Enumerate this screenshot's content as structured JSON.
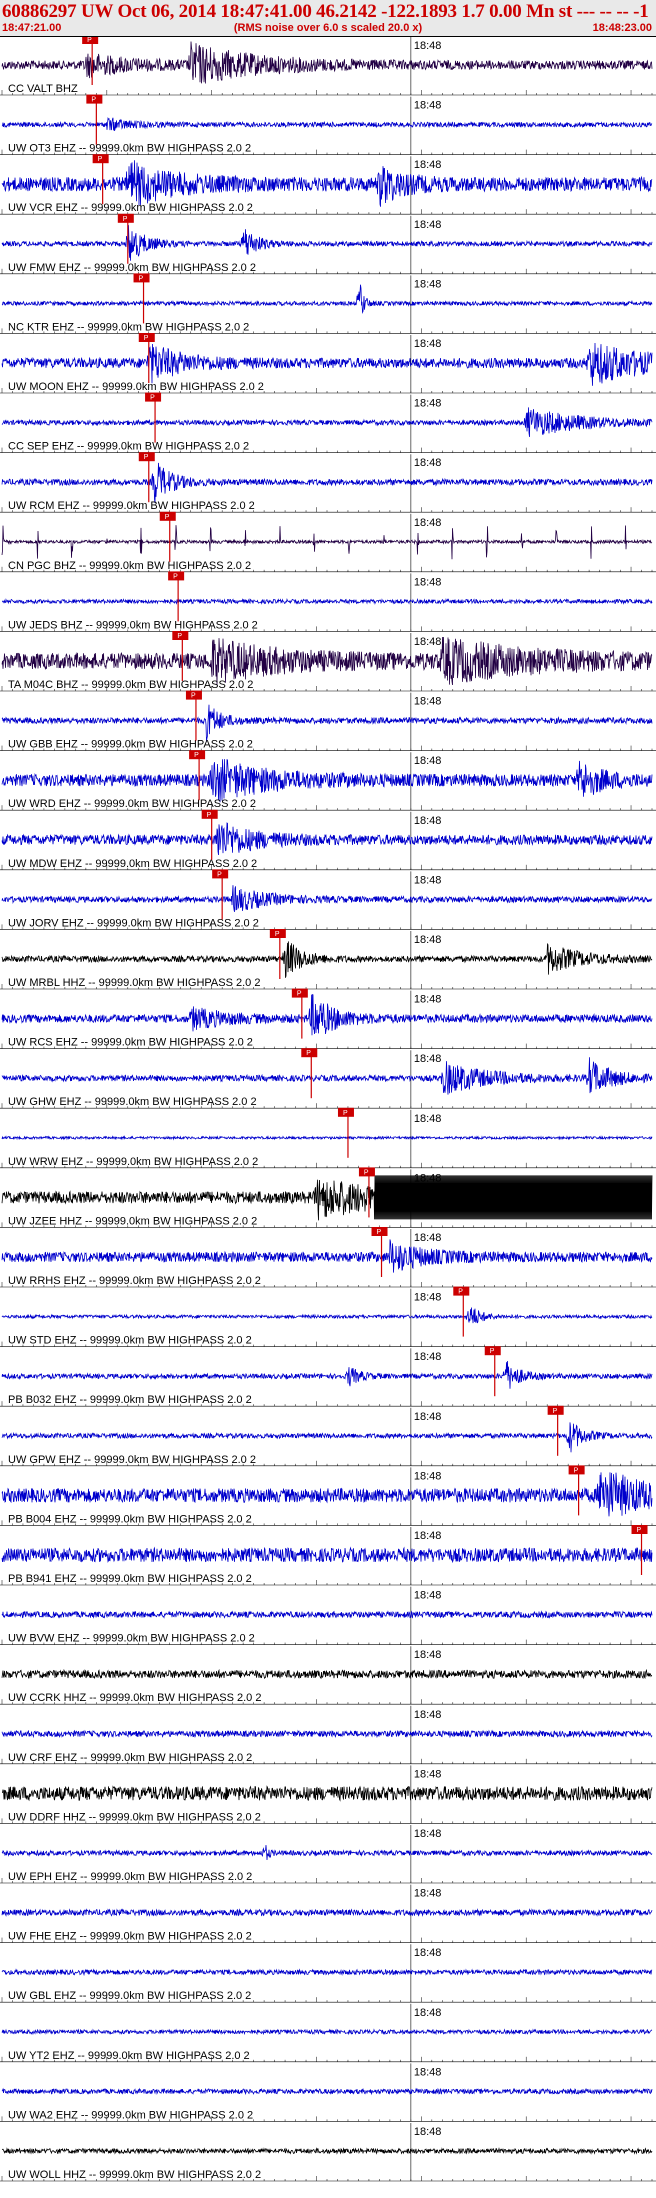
{
  "header": {
    "title": "60886297 UW Oct 06, 2014 18:47:41.00   46.2142 -122.1893  1.7 0.00 Mn st --- -- -- -1",
    "start_time": "18:47:21.00",
    "rms_note": "(RMS noise over 6.0 s scaled 20.0 x)",
    "end_time": "18:48:23.00"
  },
  "chart_data": {
    "type": "line",
    "x_range_sec": [
      0,
      62
    ],
    "minute_mark": {
      "label": "18:48",
      "t": 39
    },
    "pick_label": "P",
    "colors": {
      "blue": "#0000cc",
      "purple": "#220044",
      "black": "#000000",
      "pick": "#cc0000"
    },
    "series": [
      {
        "name": "CC VALT BHZ",
        "label": "CC VALT BHZ",
        "color": "purple",
        "pick_t": 8.6,
        "amp": 0.22,
        "bursts": [
          [
            18,
            0.95,
            6
          ],
          [
            8,
            0.5,
            4
          ]
        ]
      },
      {
        "name": "UW OT3 EHZ",
        "label": "UW OT3 EHZ -- 99999.0km BW  HIGHPASS  2.0  2",
        "color": "blue",
        "pick_t": 9.0,
        "amp": 0.12,
        "bursts": [
          [
            10,
            0.3,
            2
          ]
        ]
      },
      {
        "name": "UW VCR EHZ",
        "label": "UW VCR EHZ -- 99999.0km BW  HIGHPASS  2.0  2",
        "color": "blue",
        "pick_t": 9.6,
        "amp": 0.35,
        "bursts": [
          [
            12,
            1.0,
            4
          ],
          [
            36,
            0.9,
            2
          ]
        ]
      },
      {
        "name": "UW FMW EHZ",
        "label": "UW FMW EHZ -- 99999.0km BW  HIGHPASS  2.0  2",
        "color": "blue",
        "pick_t": 12.0,
        "amp": 0.12,
        "bursts": [
          [
            12,
            1.0,
            1.5
          ],
          [
            23,
            0.9,
            1.2
          ]
        ]
      },
      {
        "name": "NC KTR EHZ",
        "label": "NC KTR EHZ -- 99999.0km BW  HIGHPASS  2.0  2",
        "color": "blue",
        "pick_t": 13.5,
        "amp": 0.1,
        "bursts": [
          [
            34,
            1.4,
            0.4
          ]
        ]
      },
      {
        "name": "UW MOON EHZ",
        "label": "UW MOON EHZ -- 99999.0km BW  HIGHPASS  2.0  2",
        "color": "blue",
        "pick_t": 14.0,
        "amp": 0.25,
        "bursts": [
          [
            14,
            0.9,
            3
          ],
          [
            56,
            1.0,
            5
          ]
        ]
      },
      {
        "name": "CC SEP EHZ",
        "label": "CC SEP EHZ -- 99999.0km BW  HIGHPASS  2.0  2",
        "color": "blue",
        "pick_t": 14.6,
        "amp": 0.12,
        "bursts": [
          [
            50,
            0.7,
            5
          ]
        ]
      },
      {
        "name": "UW RCM EHZ",
        "label": "UW RCM EHZ -- 99999.0km BW  HIGHPASS  2.0  2",
        "color": "blue",
        "pick_t": 14.0,
        "amp": 0.15,
        "bursts": [
          [
            14.5,
            1.1,
            1.5
          ]
        ]
      },
      {
        "name": "CN PGC BHZ",
        "label": "CN PGC BHZ -- 99999.0km BW  HIGHPASS  2.0  2",
        "color": "purple",
        "pick_t": 16.0,
        "amp": 0.08,
        "spikes": true
      },
      {
        "name": "UW JEDS BHZ",
        "label": "UW JEDS BHZ -- 99999.0km BW  HIGHPASS  2.0  2",
        "color": "blue",
        "pick_t": 16.8,
        "amp": 0.1,
        "bursts": []
      },
      {
        "name": "TA M04C BHZ",
        "label": "TA M04C BHZ -- 99999.0km BW  HIGHPASS  2.0  2",
        "color": "purple",
        "pick_t": 17.2,
        "amp": 0.4,
        "bursts": [
          [
            20,
            0.9,
            6
          ],
          [
            42,
            0.9,
            8
          ]
        ]
      },
      {
        "name": "UW GBB EHZ",
        "label": "UW GBB EHZ -- 99999.0km BW  HIGHPASS  2.0  2",
        "color": "blue",
        "pick_t": 18.5,
        "amp": 0.15,
        "bursts": [
          [
            19.5,
            0.9,
            1.2
          ]
        ]
      },
      {
        "name": "UW WRD EHZ",
        "label": "UW WRD EHZ -- 99999.0km BW  HIGHPASS  2.0  2",
        "color": "blue",
        "pick_t": 18.8,
        "amp": 0.3,
        "bursts": [
          [
            20,
            1.0,
            5
          ],
          [
            55,
            0.9,
            2
          ]
        ]
      },
      {
        "name": "UW MDW EHZ",
        "label": "UW MDW EHZ -- 99999.0km BW  HIGHPASS  2.0  2",
        "color": "blue",
        "pick_t": 20.0,
        "amp": 0.25,
        "bursts": [
          [
            20.5,
            0.9,
            3
          ]
        ]
      },
      {
        "name": "UW JORV EHZ",
        "label": "UW JORV EHZ -- 99999.0km BW  HIGHPASS  2.0  2",
        "color": "blue",
        "pick_t": 21.0,
        "amp": 0.15,
        "bursts": [
          [
            22,
            0.6,
            3
          ]
        ]
      },
      {
        "name": "UW MRBL HHZ",
        "label": "UW MRBL HHZ -- 99999.0km BW  HIGHPASS  2.0  2",
        "color": "black",
        "pick_t": 26.5,
        "amp": 0.15,
        "bursts": [
          [
            27,
            1.0,
            1.5
          ],
          [
            52,
            0.7,
            3
          ]
        ]
      },
      {
        "name": "UW RCS EHZ",
        "label": "UW RCS EHZ -- 99999.0km BW  HIGHPASS  2.0  2",
        "color": "blue",
        "pick_t": 28.6,
        "amp": 0.2,
        "bursts": [
          [
            29.5,
            1.2,
            2
          ],
          [
            18,
            0.5,
            3
          ]
        ]
      },
      {
        "name": "UW GHW EHZ",
        "label": "UW GHW EHZ -- 99999.0km BW  HIGHPASS  2.0  2",
        "color": "blue",
        "pick_t": 29.5,
        "amp": 0.15,
        "bursts": [
          [
            42,
            0.8,
            4
          ],
          [
            56,
            0.9,
            2
          ]
        ]
      },
      {
        "name": "UW WRW EHZ",
        "label": "UW WRW EHZ -- 99999.0km BW  HIGHPASS  2.0  2",
        "color": "blue",
        "pick_t": 33.0,
        "amp": 0.06,
        "bursts": []
      },
      {
        "name": "UW JZEE HHZ",
        "label": "UW JZEE HHZ -- 99999.0km BW  HIGHPASS  2.0  2",
        "color": "black",
        "pick_t": 35.0,
        "amp": 0.3,
        "bursts": [
          [
            30,
            0.9,
            6
          ]
        ],
        "clip_from": 35.5
      },
      {
        "name": "UW RRHS EHZ",
        "label": "UW RRHS EHZ -- 99999.0km BW  HIGHPASS  2.0  2",
        "color": "blue",
        "pick_t": 36.2,
        "amp": 0.25,
        "bursts": [
          [
            37,
            0.7,
            3
          ]
        ]
      },
      {
        "name": "UW STD EHZ",
        "label": "UW STD EHZ -- 99999.0km BW  HIGHPASS  2.0  2",
        "color": "blue",
        "pick_t": 44.0,
        "amp": 0.08,
        "bursts": [
          [
            44.5,
            0.7,
            1
          ]
        ]
      },
      {
        "name": "PB B032 EHZ",
        "label": "PB B032 EHZ -- 99999.0km BW  HIGHPASS  2.0  2",
        "color": "blue",
        "pick_t": 47.0,
        "amp": 0.12,
        "bursts": [
          [
            48,
            0.8,
            1.2
          ],
          [
            33,
            0.5,
            1
          ]
        ]
      },
      {
        "name": "UW GPW EHZ",
        "label": "UW GPW EHZ -- 99999.0km BW  HIGHPASS  2.0  2",
        "color": "blue",
        "pick_t": 53.0,
        "amp": 0.12,
        "bursts": [
          [
            54,
            0.9,
            1.2
          ]
        ]
      },
      {
        "name": "PB B004 EHZ",
        "label": "PB B004 EHZ -- 99999.0km BW  HIGHPASS  2.0  2",
        "color": "blue",
        "pick_t": 55.0,
        "amp": 0.35,
        "bursts": [
          [
            57,
            1.2,
            4
          ]
        ]
      },
      {
        "name": "PB B941 EHZ",
        "label": "PB B941 EHZ -- 99999.0km BW  HIGHPASS  2.0  2",
        "color": "blue",
        "pick_t": 61.0,
        "amp": 0.35,
        "bursts": []
      },
      {
        "name": "UW BVW EHZ",
        "label": "UW BVW EHZ -- 99999.0km BW  HIGHPASS  2.0  2",
        "color": "blue",
        "amp": 0.15,
        "bursts": []
      },
      {
        "name": "UW CCRK HHZ",
        "label": "UW CCRK HHZ -- 99999.0km BW  HIGHPASS  2.0  2",
        "color": "black",
        "amp": 0.2,
        "bursts": []
      },
      {
        "name": "UW CRF EHZ",
        "label": "UW CRF EHZ -- 99999.0km BW  HIGHPASS  2.0  2",
        "color": "blue",
        "amp": 0.15,
        "bursts": []
      },
      {
        "name": "UW DDRF HHZ",
        "label": "UW DDRF HHZ -- 99999.0km BW  HIGHPASS  2.0  2",
        "color": "black",
        "amp": 0.35,
        "bursts": []
      },
      {
        "name": "UW EPH EHZ",
        "label": "UW EPH EHZ -- 99999.0km BW  HIGHPASS  2.0  2",
        "color": "blue",
        "amp": 0.12,
        "bursts": [
          [
            25,
            0.6,
            0.3
          ]
        ]
      },
      {
        "name": "UW FHE EHZ",
        "label": "UW FHE EHZ -- 99999.0km BW  HIGHPASS  2.0  2",
        "color": "blue",
        "amp": 0.15,
        "bursts": []
      },
      {
        "name": "UW GBL EHZ",
        "label": "UW GBL EHZ -- 99999.0km BW  HIGHPASS  2.0  2",
        "color": "blue",
        "amp": 0.12,
        "bursts": []
      },
      {
        "name": "UW YT2 EHZ",
        "label": "UW YT2 EHZ -- 99999.0km BW  HIGHPASS  2.0  2",
        "color": "blue",
        "amp": 0.1,
        "bursts": []
      },
      {
        "name": "UW WA2 EHZ",
        "label": "UW WA2 EHZ -- 99999.0km BW  HIGHPASS  2.0  2",
        "color": "blue",
        "amp": 0.12,
        "bursts": []
      },
      {
        "name": "UW WOLL HHZ",
        "label": "UW WOLL HHZ -- 99999.0km BW  HIGHPASS  2.0  2",
        "color": "black",
        "amp": 0.12,
        "bursts": []
      }
    ]
  }
}
